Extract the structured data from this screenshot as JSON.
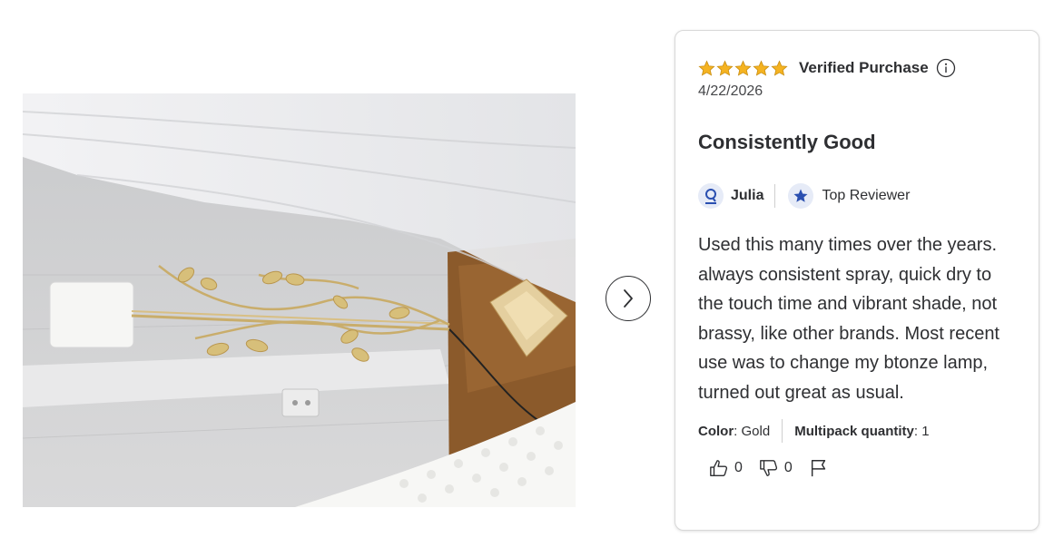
{
  "review": {
    "rating": 5,
    "verified_label": "Verified Purchase",
    "date": "4/22/2026",
    "title": "Consistently Good",
    "reviewer_name": "Julia",
    "badge_label": "Top Reviewer",
    "body": "Used this many times over the years. always consistent spray, quick dry to the touch time and vibrant shade, not brassy, like other brands. Most recent use was to change my btonze lamp, turned out great as usual.",
    "attributes": [
      {
        "label": "Color",
        "value": ": Gold"
      },
      {
        "label": "Multipack quantity",
        "value": ": 1"
      }
    ],
    "helpful_count": "0",
    "unhelpful_count": "0"
  },
  "colors": {
    "star": "#f5b321",
    "accent_blue": "#2a4fb0",
    "text": "#2e2f32"
  },
  "icons": {
    "next": "chevron-right-icon",
    "info": "info-icon",
    "avatar": "person-icon",
    "badge": "star-badge-icon",
    "thumbs_up": "thumbs-up-icon",
    "thumbs_down": "thumbs-down-icon",
    "flag": "flag-icon"
  }
}
